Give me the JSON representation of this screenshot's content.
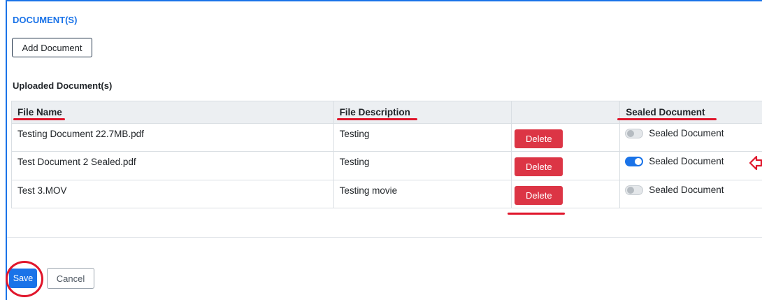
{
  "section": {
    "title": "DOCUMENT(S)"
  },
  "add_button": {
    "label": "Add Document"
  },
  "uploaded": {
    "label": "Uploaded Document(s)"
  },
  "table": {
    "headers": [
      "File Name",
      "File Description",
      "",
      "Sealed Document"
    ],
    "rows": [
      {
        "file_name": "Testing Document 22.7MB.pdf",
        "description": "Testing",
        "delete_label": "Delete",
        "sealed_label": "Sealed Document",
        "sealed": false
      },
      {
        "file_name": "Test Document 2 Sealed.pdf",
        "description": "Testing",
        "delete_label": "Delete",
        "sealed_label": "Sealed Document",
        "sealed": true
      },
      {
        "file_name": "Test 3.MOV",
        "description": "Testing movie",
        "delete_label": "Delete",
        "sealed_label": "Sealed Document",
        "sealed": false
      }
    ]
  },
  "footer": {
    "save_label": "Save",
    "cancel_label": "Cancel"
  },
  "colors": {
    "accent": "#1a73e8",
    "danger": "#dc3545",
    "annotation": "#e0162b"
  },
  "icons": {
    "annotation_arrow": "left-arrow-icon"
  }
}
